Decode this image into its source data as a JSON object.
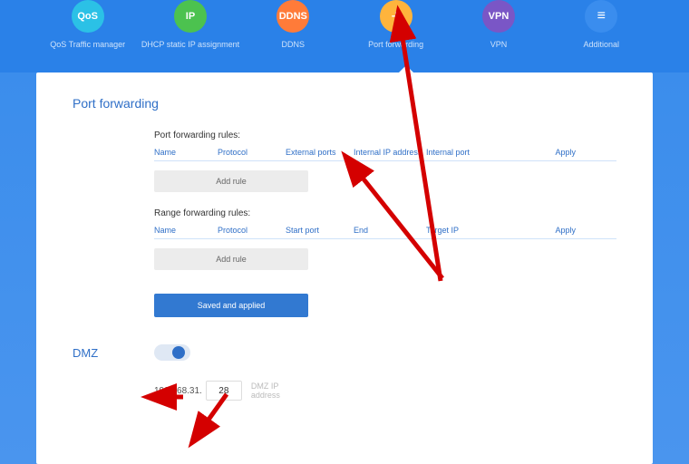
{
  "nav": {
    "items": [
      {
        "icon_text": "QoS",
        "label": "QoS Traffic manager"
      },
      {
        "icon_text": "IP",
        "label": "DHCP static IP assignment"
      },
      {
        "icon_text": "DDNS",
        "label": "DDNS"
      },
      {
        "icon_text": "+",
        "label": "Port forwarding"
      },
      {
        "icon_text": "VPN",
        "label": "VPN"
      },
      {
        "icon_text": "≡",
        "label": "Additional"
      }
    ]
  },
  "page": {
    "title": "Port forwarding"
  },
  "port_rules": {
    "title": "Port forwarding rules:",
    "cols": {
      "name": "Name",
      "protocol": "Protocol",
      "external": "External ports",
      "ip": "Internal IP address",
      "port": "Internal port",
      "apply": "Apply"
    },
    "add": "Add rule"
  },
  "range_rules": {
    "title": "Range forwarding rules:",
    "cols": {
      "name": "Name",
      "protocol": "Protocol",
      "start": "Start port",
      "end": "End",
      "target": "Target IP",
      "apply": "Apply"
    },
    "add": "Add rule"
  },
  "buttons": {
    "save": "Saved and applied"
  },
  "dmz": {
    "label": "DMZ",
    "ip_prefix": "192.168.31.",
    "ip_last": "28",
    "help1": "DMZ IP",
    "help2": "address"
  }
}
